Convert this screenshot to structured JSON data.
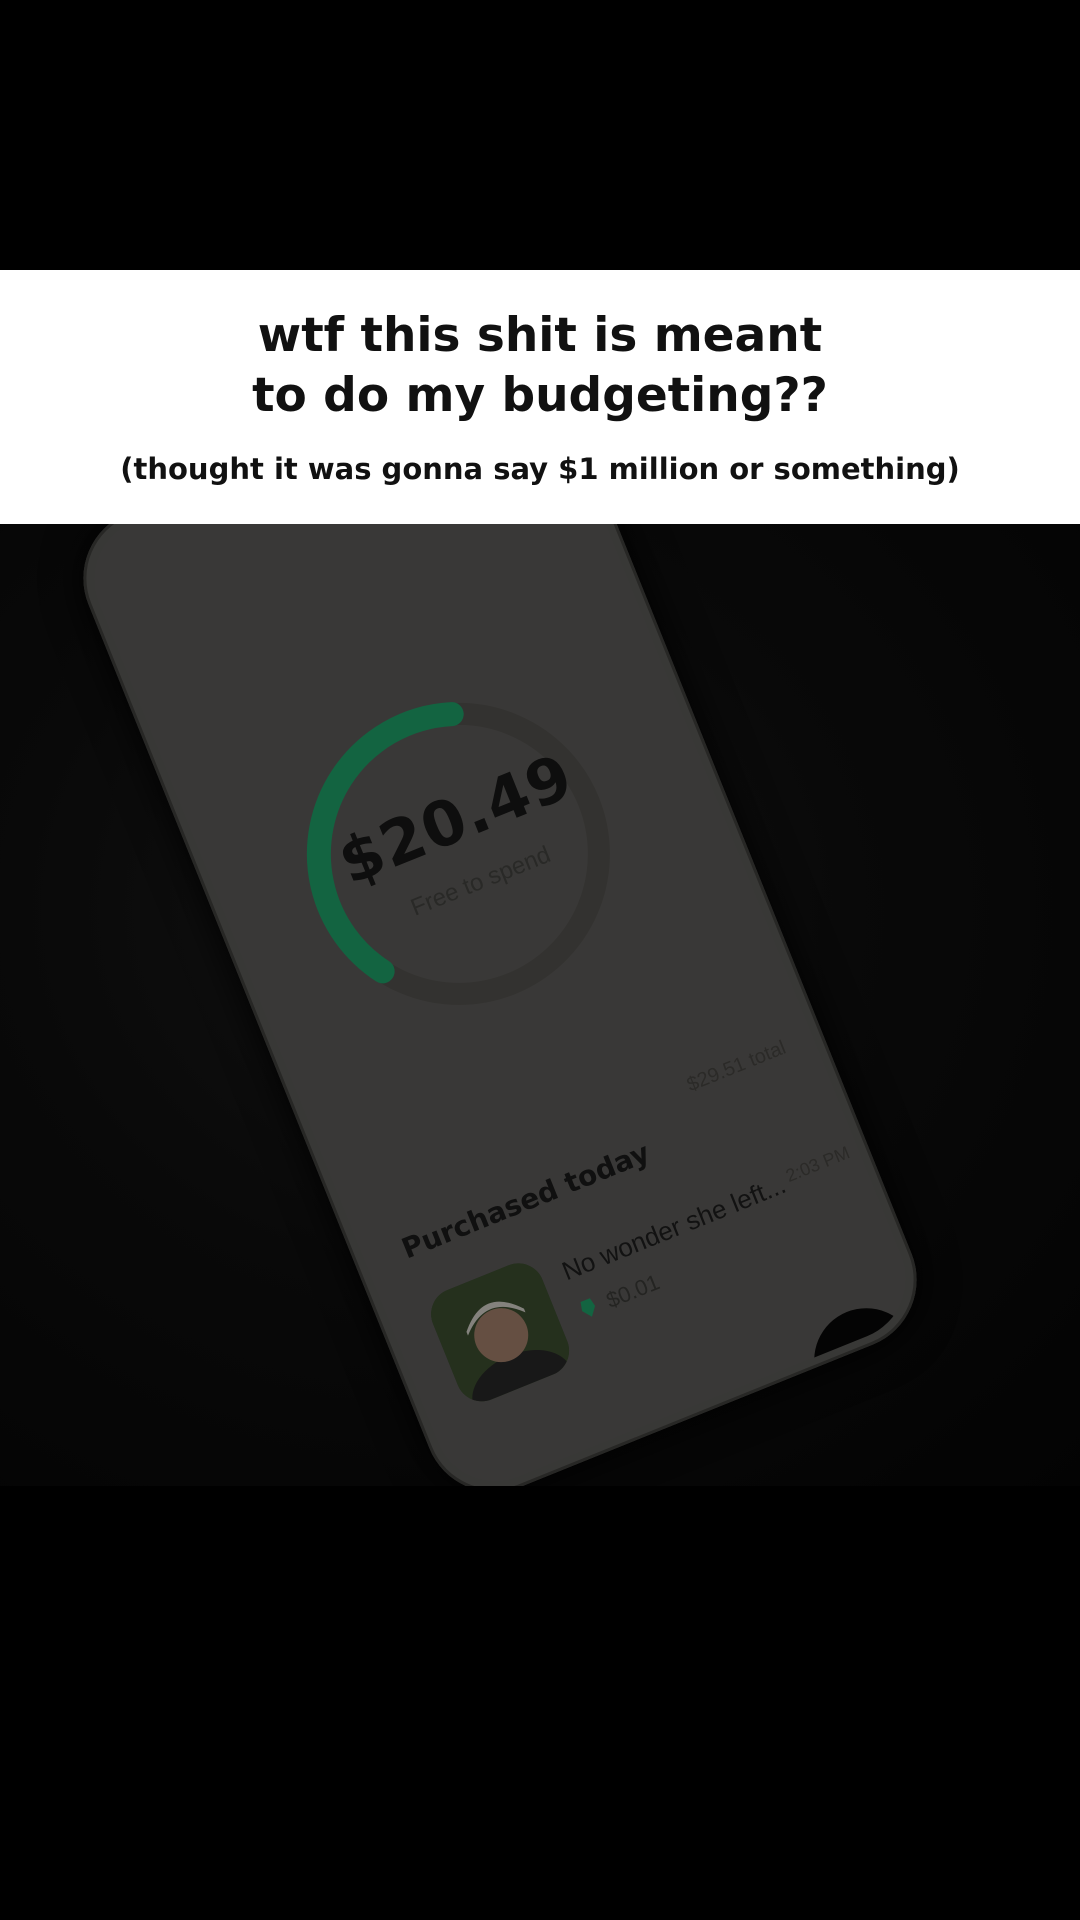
{
  "caption": {
    "title_line1": "wtf this shit is meant",
    "title_line2": "to do my budgeting??",
    "subtitle": "(thought it was gonna say $1 million or something)"
  },
  "app": {
    "balance": "$20.49",
    "balance_label": "Free to spend",
    "spend_progress": 0.4,
    "total": "$29.51 total",
    "section_title": "Purchased today",
    "purchase": {
      "name": "No wonder she left...",
      "time": "2:03 PM",
      "price": "$0.01"
    },
    "fab_label": "+",
    "tabs": [
      "home-icon",
      "trend-chart-icon",
      "profile-icon"
    ]
  },
  "colors": {
    "accent_green": "#156a45",
    "caption_bg": "#ffffff",
    "caption_text": "#111111"
  }
}
